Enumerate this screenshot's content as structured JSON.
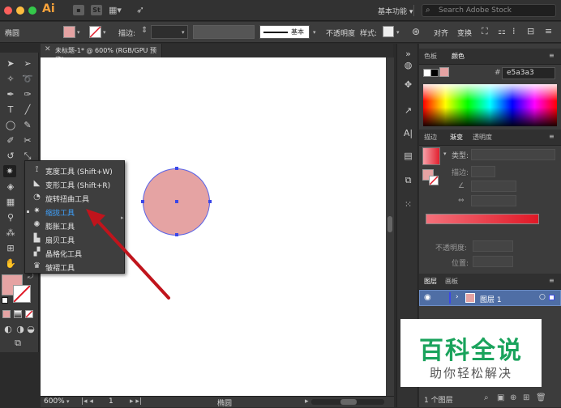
{
  "titlebar": {
    "app_logo": "Ai",
    "st_badge": "St",
    "workspace": "基本功能",
    "search_placeholder": "Search Adobe Stock",
    "colors": {
      "close": "#fc605c",
      "minimize": "#fdbc40",
      "zoom": "#34c84a",
      "logo": "#f7a23b"
    }
  },
  "controlbar": {
    "object_type": "椭圆",
    "stroke_label": "描边:",
    "brush_name": "基本",
    "opacity_label": "不透明度",
    "style_label": "样式:",
    "align_label": "对齐",
    "transform_label": "变换",
    "fill_color": "#e5a3a3"
  },
  "document": {
    "tab_title": "未标题-1* @ 600% (RGB/GPU 预览)",
    "zoom_value": "600%",
    "page_number": "1",
    "status_text": "椭圆"
  },
  "canvas": {
    "circle_fill": "#e5a3a3",
    "selection_color": "#3b47e8"
  },
  "flyout": {
    "items": [
      {
        "icon": "width-tool-icon",
        "label": "宽度工具  (Shift+W)"
      },
      {
        "icon": "warp-tool-icon",
        "label": "变形工具  (Shift+R)"
      },
      {
        "icon": "twirl-tool-icon",
        "label": "旋转扭曲工具"
      },
      {
        "icon": "pucker-tool-icon",
        "label": "缩拢工具",
        "current": true
      },
      {
        "icon": "bloat-tool-icon",
        "label": "膨胀工具"
      },
      {
        "icon": "scallop-tool-icon",
        "label": "扇贝工具"
      },
      {
        "icon": "crystallize-tool-icon",
        "label": "晶格化工具"
      },
      {
        "icon": "wrinkle-tool-icon",
        "label": "皱褶工具"
      }
    ]
  },
  "color_panel": {
    "tabs": [
      "色板",
      "颜色"
    ],
    "hash": "#",
    "hex_value": "e5a3a3"
  },
  "gradient_panel": {
    "tabs": [
      "描边",
      "渐变",
      "透明度"
    ],
    "type_label": "类型:",
    "stroke_label": "描边:",
    "opacity_label": "不透明度:",
    "position_label": "位置:"
  },
  "layers_panel": {
    "tabs": [
      "图层",
      "画板"
    ],
    "layer_name": "图层 1",
    "layer_count": "1 个图层"
  },
  "watermark": {
    "title": "百科全说",
    "subtitle": "助你轻松解决"
  }
}
